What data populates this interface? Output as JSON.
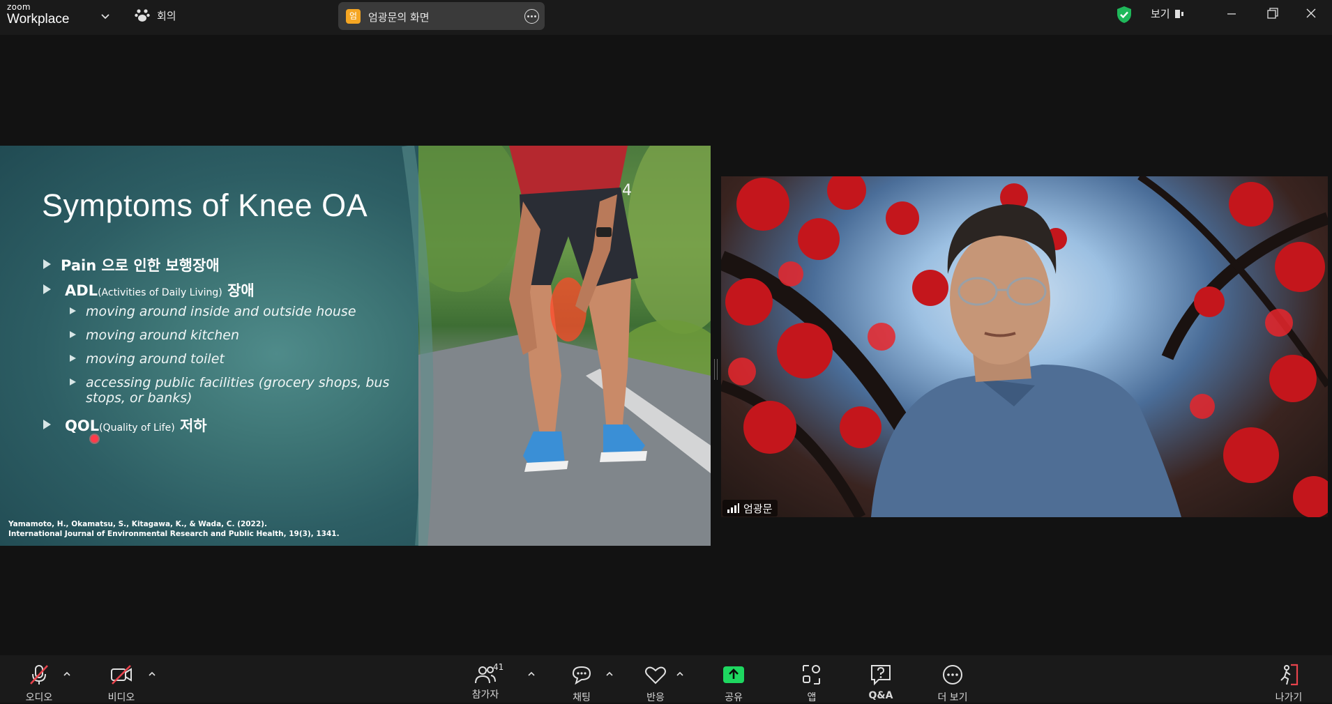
{
  "app": {
    "brand_small": "zoom",
    "brand_name": "Workplace"
  },
  "titlebar": {
    "meeting_tab_label": "회의",
    "share_badge": "엄",
    "share_label": "엄광문의 화면",
    "view_label": "보기",
    "colors": {
      "shield": "#1fb85a",
      "badge": "#f5a623"
    }
  },
  "slide": {
    "number": "4",
    "title": "Symptoms of Knee OA",
    "bullets": [
      {
        "main": "Pain 으로 인한 보행장애",
        "sub": "",
        "after": ""
      },
      {
        "main": "ADL",
        "sub": "(Activities of Daily Living)",
        "after": " 장애"
      },
      {
        "main": "QOL",
        "sub": "(Quality of Life)",
        "after": " 저하"
      }
    ],
    "subbullets": [
      "moving around inside and outside house",
      "moving around kitchen",
      "moving around toilet",
      "accessing public facilities (grocery shops, bus",
      "stops, or banks)"
    ],
    "citation_line1": "Yamamoto, H., Okamatsu, S., Kitagawa, K., & Wada, C. (2022).",
    "citation_line2": "International Journal of Environmental Research and Public Health, 19(3), 1341."
  },
  "participant": {
    "name": "엄광문"
  },
  "toolbar": {
    "audio": "오디오",
    "video": "비디오",
    "participants": "참가자",
    "participants_count": "41",
    "chat": "채팅",
    "reactions": "반응",
    "share": "공유",
    "apps": "앱",
    "qa": "Q&A",
    "more": "더 보기",
    "leave": "나가기",
    "colors": {
      "share_green": "#1ed760",
      "leave_red": "#e8434c",
      "muted_red": "#e8434c"
    }
  }
}
